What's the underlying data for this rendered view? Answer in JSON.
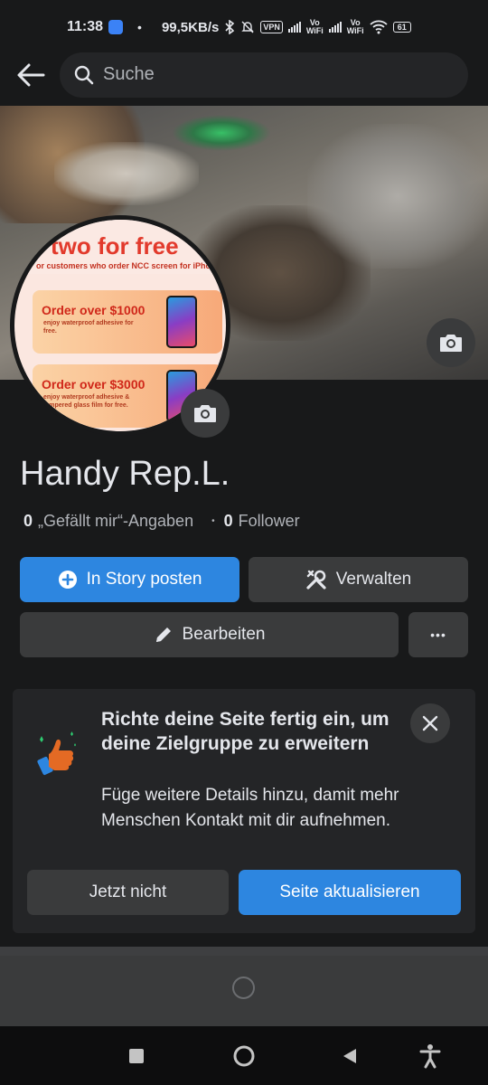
{
  "status_bar": {
    "time": "11:38",
    "speed": "99,5KB/s",
    "vpn": "VPN",
    "vo_wifi": "Vo\nWiFi",
    "battery": "61"
  },
  "search": {
    "placeholder": "Suche"
  },
  "profile": {
    "avatar_title": "two for free",
    "avatar_subtitle": "or customers who order NCC screen for iPho",
    "avatar_card1_title": "Order over $1000",
    "avatar_card1_sub": "enjoy waterproof adhesive for free.",
    "avatar_card2_title": "Order over $3000",
    "avatar_card2_sub": "enjoy waterproof adhesive & tempered glass film for free.",
    "name": "Handy Rep.L.",
    "likes_count": "0",
    "likes_label": "„Gefällt mir“-Angaben",
    "followers_count": "0",
    "followers_label": "Follower"
  },
  "actions": {
    "story_label": "In Story posten",
    "manage_label": "Verwalten",
    "edit_label": "Bearbeiten",
    "more_label": "•••"
  },
  "setup_card": {
    "title": "Richte deine Seite fertig ein, um deine Zielgruppe zu erweitern",
    "description": "Füge weitere Details hinzu, damit mehr Menschen Kontakt mit dir aufnehmen.",
    "not_now_label": "Jetzt nicht",
    "update_label": "Seite aktualisieren"
  },
  "colors": {
    "accent": "#2d86e0",
    "background": "#18191a",
    "surface": "#3a3b3c"
  }
}
